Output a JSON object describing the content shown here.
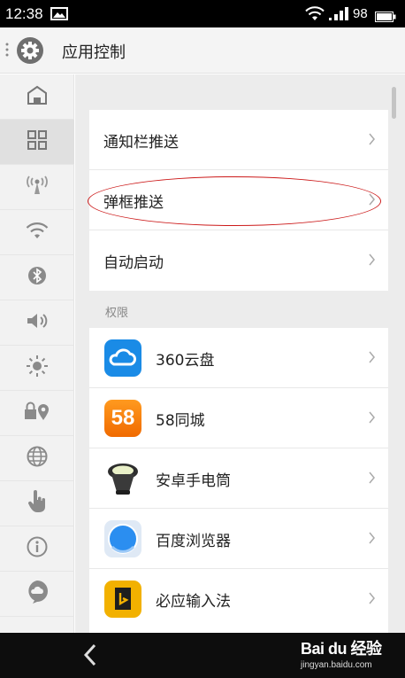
{
  "status_bar": {
    "time": "12:38",
    "battery": "98"
  },
  "header": {
    "title": "应用控制"
  },
  "sidebar": {
    "items": [
      {
        "icon": "home-icon"
      },
      {
        "icon": "apps-grid-icon"
      },
      {
        "icon": "antenna-icon"
      },
      {
        "icon": "wifi-icon"
      },
      {
        "icon": "bluetooth-icon"
      },
      {
        "icon": "volume-icon"
      },
      {
        "icon": "brightness-icon"
      },
      {
        "icon": "lock-location-icon"
      },
      {
        "icon": "globe-icon"
      },
      {
        "icon": "hand-pointer-icon"
      },
      {
        "icon": "info-icon"
      },
      {
        "icon": "cloud-chat-icon"
      }
    ]
  },
  "push_settings": [
    {
      "label": "通知栏推送"
    },
    {
      "label": "弹框推送"
    },
    {
      "label": "自动启动"
    }
  ],
  "permissions": {
    "title": "权限",
    "apps": [
      {
        "name": "360云盘",
        "icon": "cloud-drive-icon",
        "icon_color": "#1a8be6"
      },
      {
        "name": "58同城",
        "icon": "58-icon",
        "icon_text": "58",
        "icon_color": "#ff7a00"
      },
      {
        "name": "安卓手电筒",
        "icon": "flashlight-icon",
        "icon_color": "#333333"
      },
      {
        "name": "百度浏览器",
        "icon": "browser-icon",
        "icon_color": "#2b8ef0"
      },
      {
        "name": "必应输入法",
        "icon": "bing-input-icon",
        "icon_color": "#f2b100"
      }
    ]
  },
  "watermark": {
    "brand": "Bai du 经验",
    "site": "jingyan.baidu.com"
  },
  "colors": {
    "accent_annotation": "#cc1a1a",
    "background": "#ececec"
  }
}
